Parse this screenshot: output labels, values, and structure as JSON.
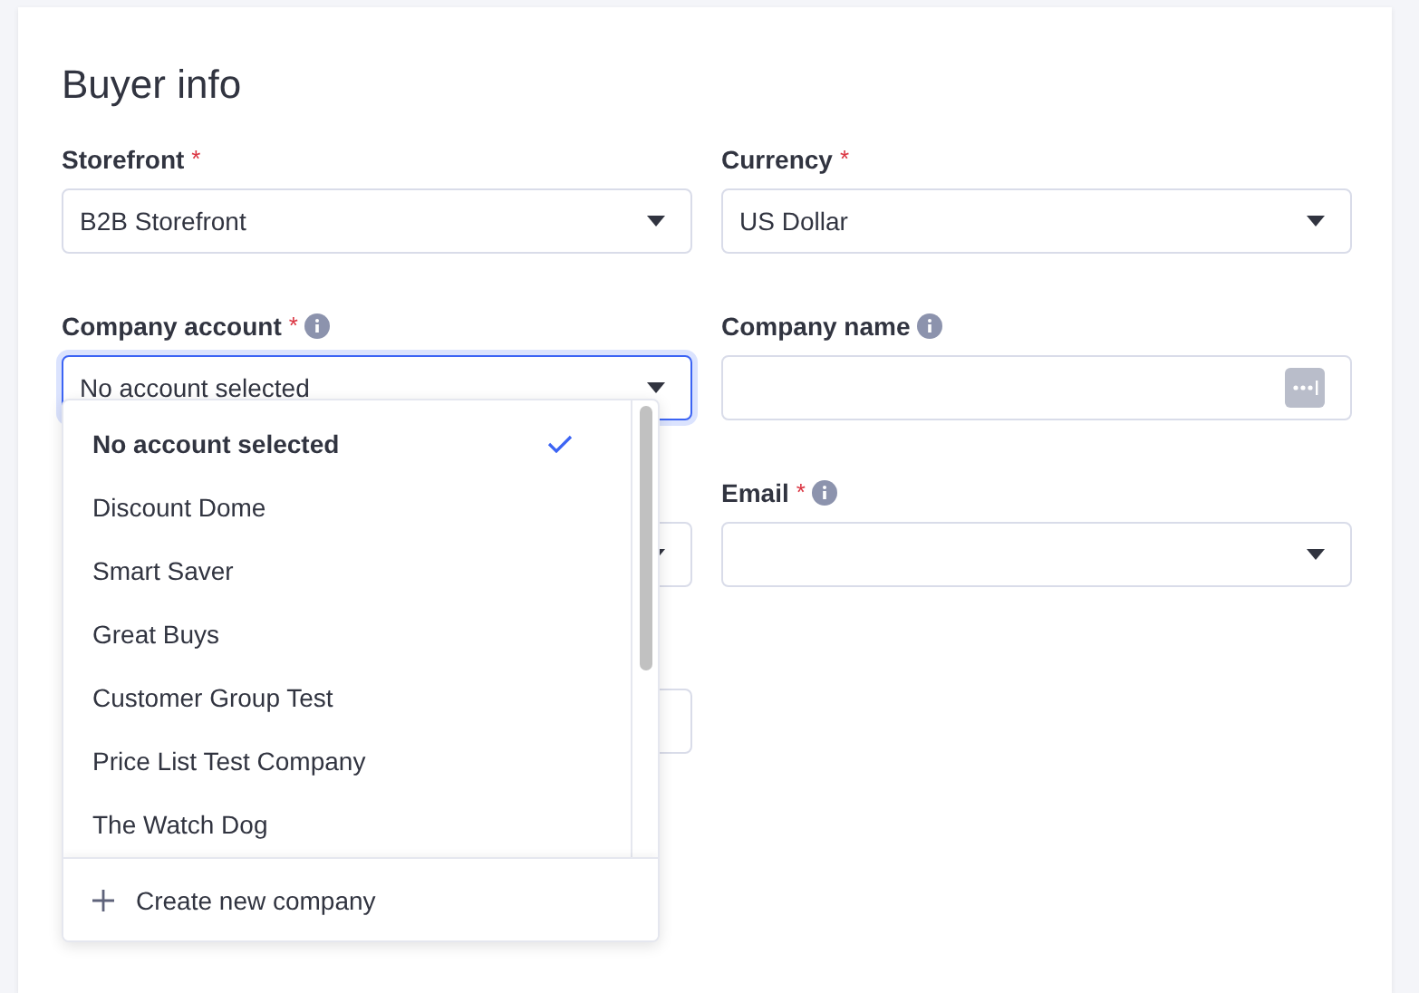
{
  "title": "Buyer info",
  "left_fields": [
    {
      "kind": "select",
      "label": "Storefront",
      "required_mark": "*",
      "info": false,
      "value": "B2B Storefront",
      "focused": false
    },
    {
      "kind": "select",
      "label": "Company account",
      "required_mark": "*",
      "info": true,
      "value": "No account selected",
      "focused": true
    },
    {
      "kind": "select",
      "focused": false
    },
    {
      "kind": "text",
      "focused": false
    }
  ],
  "right_fields": [
    {
      "kind": "select",
      "label": "Currency",
      "required_mark": "*",
      "info": false,
      "value": "US Dollar",
      "focused": false
    },
    {
      "kind": "text",
      "label": "Company name",
      "info": true,
      "focused": false
    },
    {
      "kind": "select",
      "label": "Email",
      "required_mark": "*",
      "info": true,
      "focused": false
    }
  ],
  "dropdown": {
    "options": [
      {
        "label": "No account selected",
        "selected": true
      },
      {
        "label": "Discount Dome",
        "selected": false
      },
      {
        "label": "Smart Saver",
        "selected": false
      },
      {
        "label": "Great Buys",
        "selected": false
      },
      {
        "label": "Customer Group Test",
        "selected": false
      },
      {
        "label": "Price List Test Company",
        "selected": false
      },
      {
        "label": "The Watch Dog",
        "selected": false
      }
    ],
    "action": "Create new company"
  }
}
